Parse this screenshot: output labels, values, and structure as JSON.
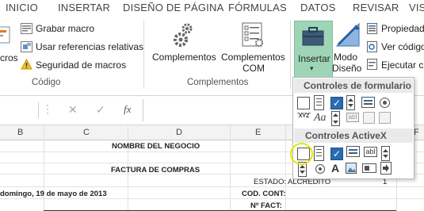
{
  "tabs": [
    "INICIO",
    "INSERTAR",
    "DISEÑO DE PÁGINA",
    "FÓRMULAS",
    "DATOS",
    "REVISAR",
    "VIST"
  ],
  "codigo": {
    "macros_partial": "cros",
    "record_macro": "Grabar macro",
    "relative_refs": "Usar referencias relativas",
    "macro_security": "Seguridad de macros",
    "group_label": "Código"
  },
  "complementos": {
    "complementos": "Complementos",
    "complementos_com_1": "Complementos",
    "complementos_com_2": "COM",
    "group_label": "Complementos"
  },
  "controles": {
    "insertar": "Insertar",
    "modo_1": "Modo",
    "modo_2": "Diseño",
    "propiedades": "Propiedad",
    "ver_codigo": "Ver código",
    "ejecutar": "Ejecutar cu"
  },
  "formula_bar": {
    "cancel": "✕",
    "enter": "✓",
    "fx": "fx"
  },
  "columns": [
    "B",
    "C",
    "D",
    "E",
    "F"
  ],
  "sheet": {
    "business_name": "NOMBRE DEL NEGOCIO",
    "invoice_title": "FACTURA DE COMPRAS",
    "estado_label": "ESTADO:",
    "estado_value": "ALCREDITO",
    "estado_number": "1",
    "date": "domingo, 19 de mayo de 2013",
    "cod_cont": "COD. CONT:",
    "n_fact": "Nº FACT:"
  },
  "dropdown": {
    "form_controls_title": "Controles de formulario",
    "activex_title": "Controles ActiveX"
  },
  "colors": {
    "highlight_green": "#9fd5b7",
    "yellow_circle": "#e6e600",
    "accent_blue": "#2b6cb0"
  }
}
